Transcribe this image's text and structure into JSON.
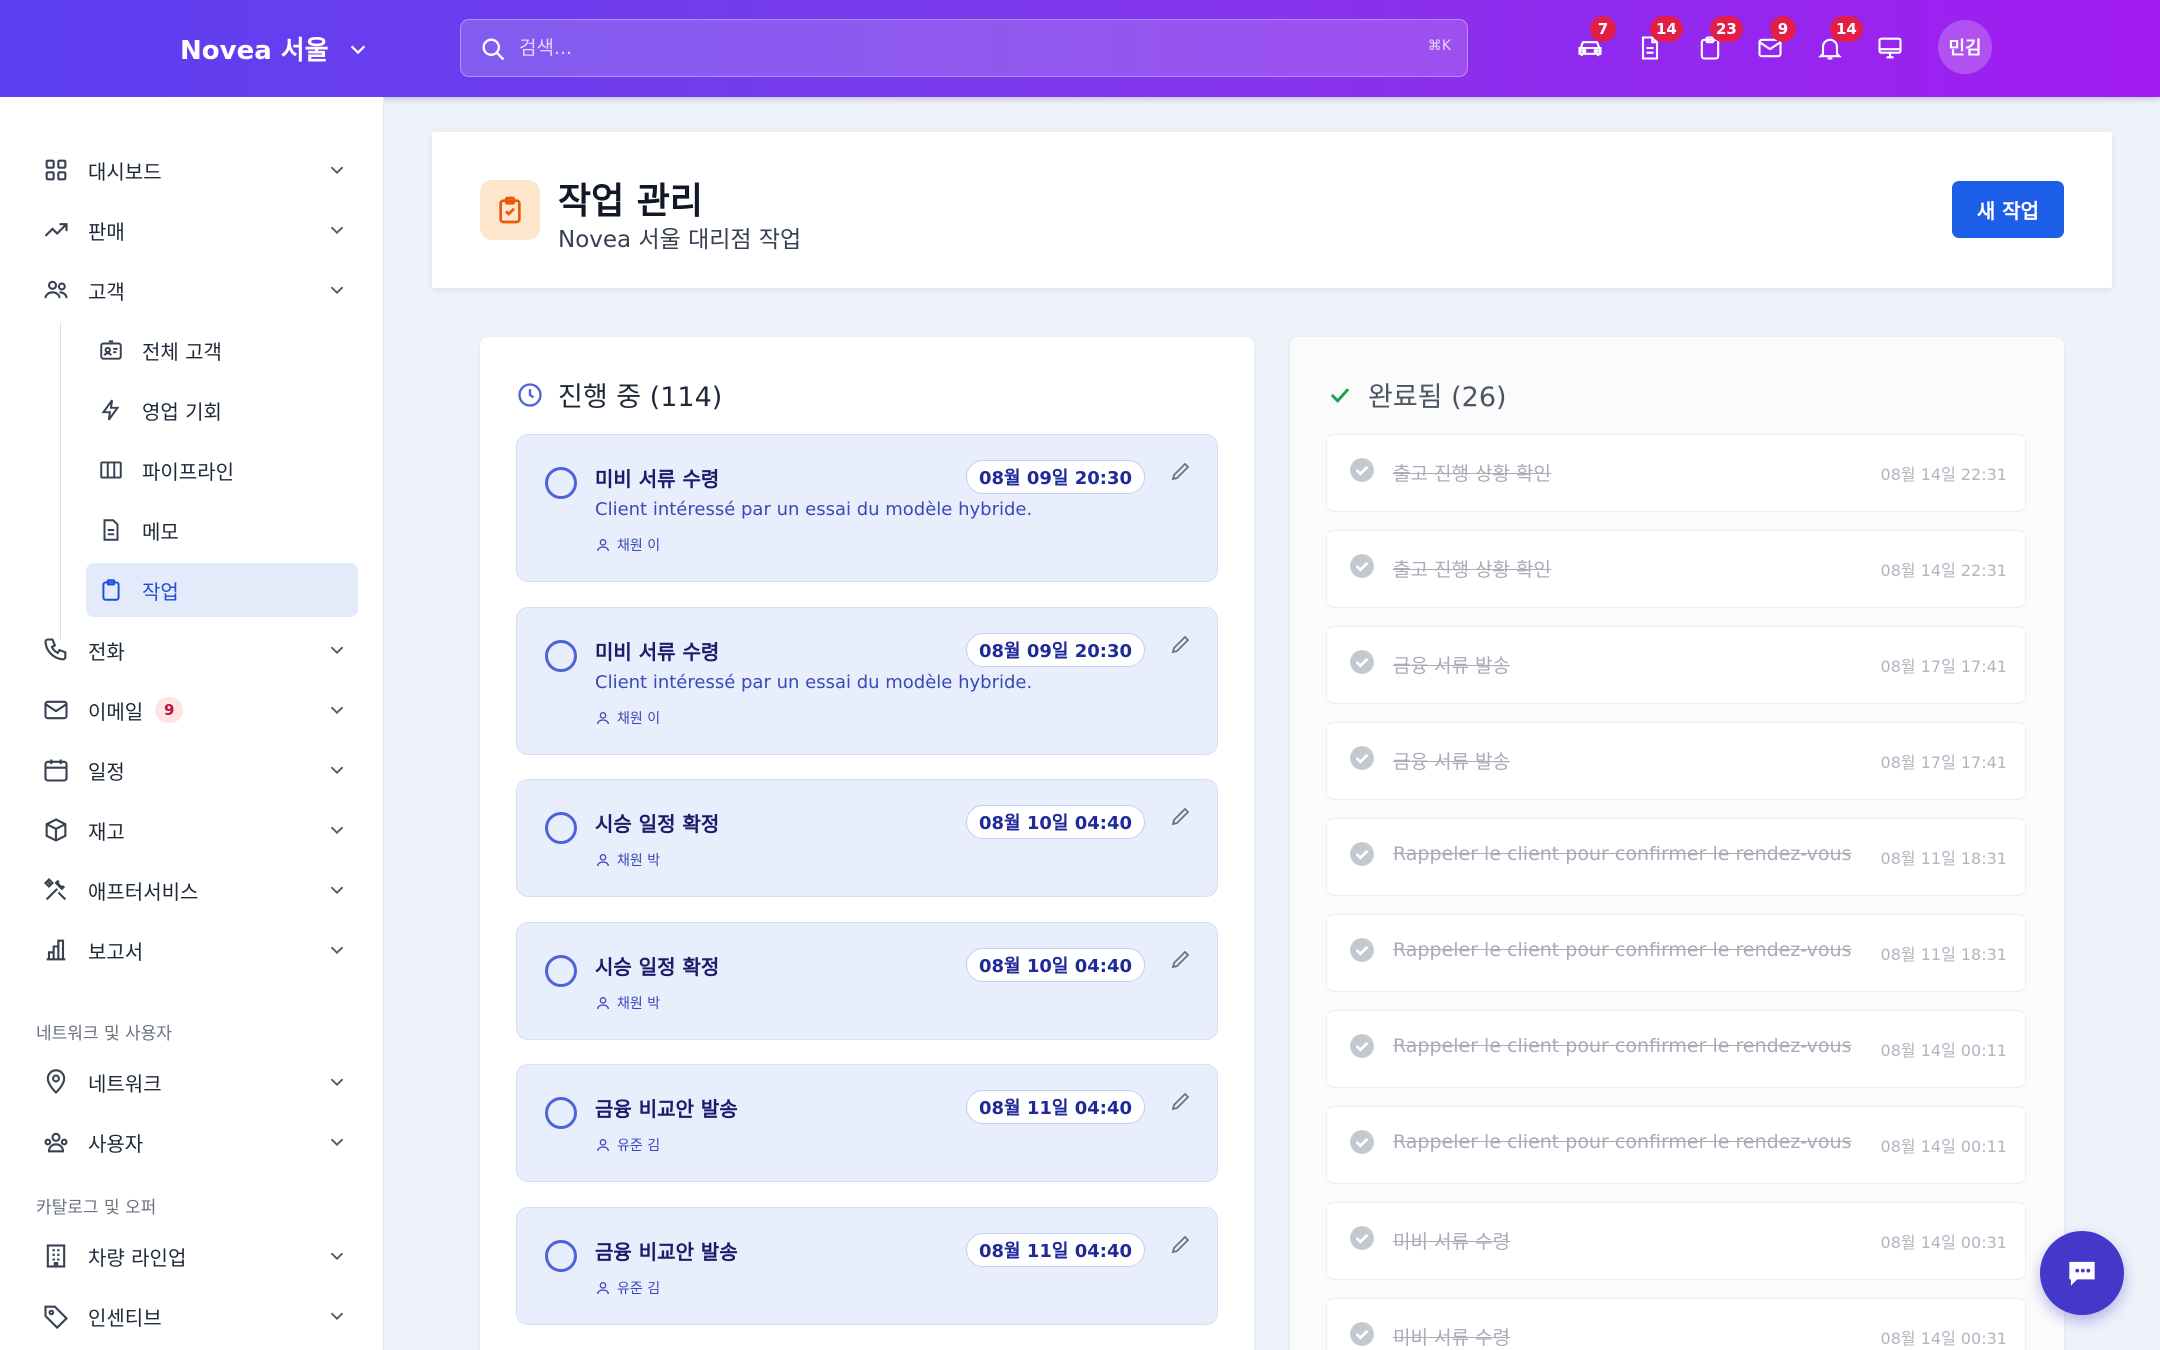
{
  "topbar": {
    "brand": "Novea 서울",
    "search_placeholder": "검색...",
    "search_shortcut": "⌘K",
    "icons": [
      {
        "name": "car-icon",
        "badge": "7"
      },
      {
        "name": "document-icon",
        "badge": "14"
      },
      {
        "name": "clipboard-icon",
        "badge": "23"
      },
      {
        "name": "mail-icon",
        "badge": "9"
      },
      {
        "name": "bell-icon",
        "badge": "14"
      },
      {
        "name": "monitor-icon",
        "badge": ""
      }
    ],
    "avatar": "민김"
  },
  "sidebar": {
    "items": [
      {
        "label": "대시보드",
        "icon": "dashboard-icon"
      },
      {
        "label": "판매",
        "icon": "trending-up-icon"
      },
      {
        "label": "고객",
        "icon": "users-icon"
      },
      {
        "label": "전체 고객",
        "icon": "id-card-icon"
      },
      {
        "label": "영업 기회",
        "icon": "lightning-icon"
      },
      {
        "label": "파이프라인",
        "icon": "columns-icon"
      },
      {
        "label": "메모",
        "icon": "note-icon"
      },
      {
        "label": "작업",
        "icon": "clipboard-icon"
      },
      {
        "label": "전화",
        "icon": "phone-icon"
      },
      {
        "label": "이메일",
        "icon": "mail-icon",
        "badge": "9"
      },
      {
        "label": "일정",
        "icon": "calendar-icon"
      },
      {
        "label": "재고",
        "icon": "box-icon"
      },
      {
        "label": "애프터서비스",
        "icon": "tools-icon"
      },
      {
        "label": "보고서",
        "icon": "report-icon"
      },
      {
        "label": "네트워크",
        "icon": "location-icon"
      },
      {
        "label": "사용자",
        "icon": "user-group-icon"
      },
      {
        "label": "차량 라인업",
        "icon": "building-icon"
      },
      {
        "label": "인센티브",
        "icon": "tag-icon"
      }
    ],
    "sections": [
      "네트워크 및 사용자",
      "카탈로그 및 오퍼"
    ]
  },
  "header": {
    "title": "작업 관리",
    "subtitle": "Novea 서울 대리점 작업",
    "new_button": "새 작업"
  },
  "in_progress": {
    "title": "진행 중 (114)",
    "tasks": [
      {
        "title": "미비 서류 수령",
        "due": "08월 09일 20:30",
        "desc": "Client intéressé par un essai du modèle hybride.",
        "assignee": "채원 이"
      },
      {
        "title": "미비 서류 수령",
        "due": "08월 09일 20:30",
        "desc": "Client intéressé par un essai du modèle hybride.",
        "assignee": "채원 이"
      },
      {
        "title": "시승 일정 확정",
        "due": "08월 10일 04:40",
        "desc": "",
        "assignee": "채원 박"
      },
      {
        "title": "시승 일정 확정",
        "due": "08월 10일 04:40",
        "desc": "",
        "assignee": "채원 박"
      },
      {
        "title": "금융 비교안 발송",
        "due": "08월 11일 04:40",
        "desc": "",
        "assignee": "유준 김"
      },
      {
        "title": "금융 비교안 발송",
        "due": "08월 11일 04:40",
        "desc": "",
        "assignee": "유준 김"
      }
    ]
  },
  "completed": {
    "title": "완료됨 (26)",
    "tasks": [
      {
        "title": "출고 진행 상황 확인",
        "date": "08월 14일 22:31"
      },
      {
        "title": "출고 진행 상황 확인",
        "date": "08월 14일 22:31"
      },
      {
        "title": "금융 서류 발송",
        "date": "08월 17일 17:41"
      },
      {
        "title": "금융 서류 발송",
        "date": "08월 17일 17:41"
      },
      {
        "title": "Rappeler le client pour confirmer le rendez-vous",
        "date": "08월 11일 18:31"
      },
      {
        "title": "Rappeler le client pour confirmer le rendez-vous",
        "date": "08월 11일 18:31"
      },
      {
        "title": "Rappeler le client pour confirmer le rendez-vous",
        "date": "08월 14일 00:11"
      },
      {
        "title": "Rappeler le client pour confirmer le rendez-vous",
        "date": "08월 14일 00:11"
      },
      {
        "title": "미비 서류 수령",
        "date": "08월 14일 00:31"
      },
      {
        "title": "미비 서류 수령",
        "date": "08월 14일 00:31"
      }
    ]
  },
  "colors": {
    "accent": "#1d5ee8",
    "topbar_start": "#5b3ff0",
    "topbar_end": "#a21cf0",
    "task_bg": "#e9eefc",
    "done_check": "#16a34a"
  }
}
